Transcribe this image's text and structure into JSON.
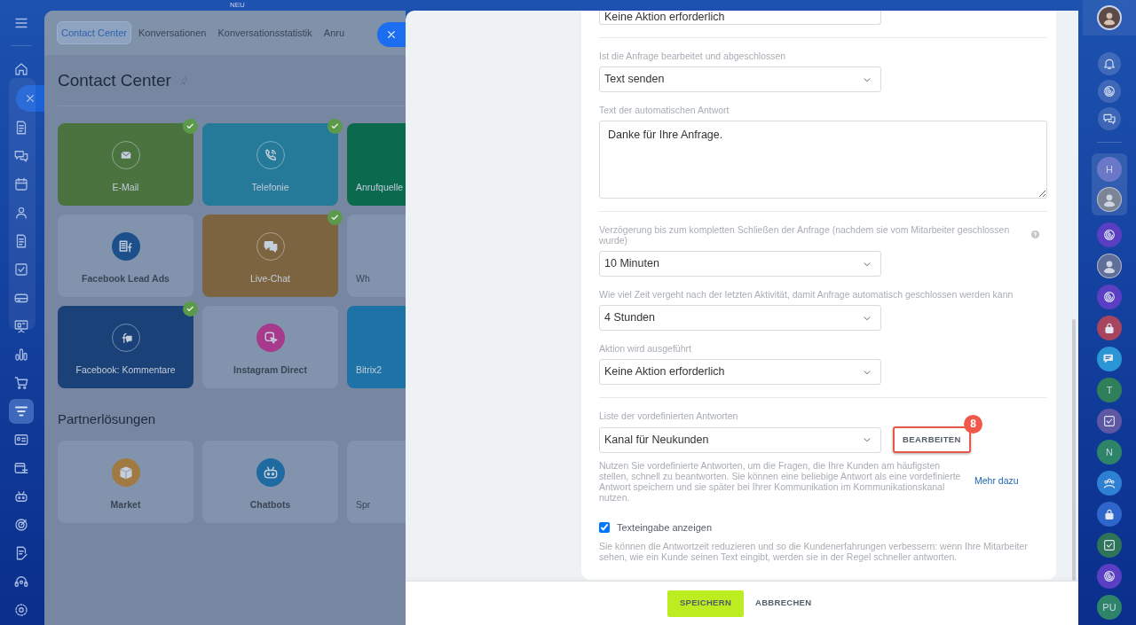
{
  "top_bar": {
    "badge": "NEU"
  },
  "left_rail": [
    {
      "kind": "menu",
      "selected": false
    },
    {
      "kind": "home",
      "selected": false
    },
    {
      "kind": "document",
      "selected": false
    },
    {
      "kind": "chat",
      "selected": false
    },
    {
      "kind": "calendar",
      "selected": false
    },
    {
      "kind": "user",
      "selected": false
    },
    {
      "kind": "document",
      "selected": false
    },
    {
      "kind": "checkbox",
      "selected": false
    },
    {
      "kind": "drive",
      "selected": false
    },
    {
      "kind": "board",
      "selected": false
    },
    {
      "kind": "bar-chart",
      "selected": false
    },
    {
      "kind": "cart",
      "selected": false
    },
    {
      "kind": "filter",
      "selected": true
    },
    {
      "kind": "contact-card",
      "selected": false
    },
    {
      "kind": "planner",
      "selected": false
    },
    {
      "kind": "robot",
      "selected": false
    },
    {
      "kind": "target",
      "selected": false
    },
    {
      "kind": "edit-document",
      "selected": false
    },
    {
      "kind": "headset",
      "selected": false
    },
    {
      "kind": "settings",
      "selected": false
    }
  ],
  "page": {
    "tabs": [
      {
        "label": "Contact Center",
        "selected": true
      },
      {
        "label": "Konversationen",
        "selected": false
      },
      {
        "label": "Konversationsstatistik",
        "selected": false
      },
      {
        "label": "Anru",
        "selected": false
      }
    ],
    "title": "Contact Center",
    "tiles": [
      {
        "label": "E-Mail",
        "kind": "mail",
        "color": "#4a7340",
        "checked": true
      },
      {
        "label": "Telefonie",
        "kind": "phone",
        "color": "#267a99",
        "checked": true
      },
      {
        "label": "Anrufquelle",
        "kind": "none",
        "color": "#0b6a4e",
        "checked": false
      },
      {
        "label": "Facebook Lead Ads",
        "kind": "form",
        "color": "#8293ad",
        "badge": {
          "color": "#1d4f8a"
        },
        "checked": false
      },
      {
        "label": "Live-Chat",
        "kind": "chat",
        "color": "#7d6440",
        "checked": true
      },
      {
        "label": "Wh",
        "kind": "none",
        "color": "#8293ad",
        "checked": false
      },
      {
        "label": "Facebook: Kommentare",
        "kind": "comment",
        "color": "#1b4278",
        "checked": true
      },
      {
        "label": "Instagram Direct",
        "kind": "send",
        "color": "#8293ad",
        "badge": {
          "color": "#a83a8c"
        },
        "checked": false
      },
      {
        "label": "Bitrix2",
        "kind": "none",
        "color": "#1e73a6",
        "checked": false
      }
    ],
    "partner_heading": "Partnerlösungen",
    "partner_tiles": [
      {
        "label": "Market",
        "kind": "box",
        "color": "#8293ad",
        "badge": {
          "color": "#a07a42"
        }
      },
      {
        "label": "Chatbots",
        "kind": "robot",
        "color": "#8293ad",
        "badge": {
          "color": "#1f6aa0"
        }
      },
      {
        "label": "Spr",
        "kind": "none",
        "color": "#8293ad"
      }
    ]
  },
  "form": [
    {
      "kind": "select",
      "value": "Keine Aktion erforderlich",
      "cut": true
    },
    {
      "kind": "divider"
    },
    {
      "kind": "select",
      "label": "Ist die Anfrage bearbeitet und abgeschlossen",
      "value": "Text senden"
    },
    {
      "kind": "textarea",
      "label": "Text der automatischen Antwort",
      "value": "Danke für Ihre Anfrage."
    },
    {
      "kind": "divider"
    },
    {
      "kind": "select",
      "label": "Verzögerung bis zum kompletten Schließen der Anfrage (nachdem sie vom Mitarbeiter geschlossen wurde)",
      "value": "10 Minuten",
      "help": true
    },
    {
      "kind": "select",
      "label": "Wie viel Zeit vergeht nach der letzten Aktivität, damit Anfrage automatisch geschlossen werden kann",
      "value": "4 Stunden"
    },
    {
      "kind": "select",
      "label": "Aktion wird ausgeführt",
      "value": "Keine Aktion erforderlich"
    },
    {
      "kind": "divider"
    },
    {
      "kind": "select",
      "label": "Liste der vordefinierten Antworten",
      "value": "Kanal für Neukunden",
      "button": {
        "label": "BEARBEITEN",
        "highlighted": true,
        "callout": "8"
      },
      "note": "Nutzen Sie vordefinierte Antworten, um die Fragen, die Ihre Kunden am häufigsten stellen, schnell zu beantworten. Sie können eine beliebige Antwort als eine vordefinierte Antwort speichern und sie später bei Ihrer Kommunikation im Kommunikationskanal nutzen.",
      "link": "Mehr dazu"
    },
    {
      "kind": "checkbox",
      "label": "Texteingabe anzeigen",
      "checked": true,
      "note": "Sie können die Antwortzeit reduzieren und so die Kundenerfahrungen verbessern: wenn Ihre Mitarbeiter sehen, wie ein Kunde seinen Text eingibt, werden sie in der Regel schneller antworten."
    }
  ],
  "footer": [
    {
      "label": "SPEICHERN",
      "kind": "primary"
    },
    {
      "label": "ABBRECHEN",
      "kind": "link"
    }
  ],
  "right_bar": {
    "chats": [
      {
        "kind": "letters",
        "text": "H",
        "color": "#6b78c8",
        "pinned": true
      },
      {
        "kind": "avatar",
        "color": "#7b8596",
        "pinned": true
      },
      {
        "kind": "swirl",
        "color": "#5a3fc4"
      },
      {
        "kind": "avatar",
        "color": "#5f6f9a"
      },
      {
        "kind": "swirl",
        "color": "#5a3fc4"
      },
      {
        "kind": "lock",
        "color": "#a8455e"
      },
      {
        "kind": "bubble",
        "color": "#2a96d6"
      },
      {
        "kind": "letters",
        "text": "T",
        "color": "#2f7f5a"
      },
      {
        "kind": "checkbox",
        "color": "#5d57a4"
      },
      {
        "kind": "letters",
        "text": "N",
        "color": "#2e8468"
      },
      {
        "kind": "group",
        "color": "#2e80d4"
      },
      {
        "kind": "lock",
        "color": "#2f66cc"
      },
      {
        "kind": "checkbox",
        "color": "#2e7458"
      },
      {
        "kind": "swirl",
        "color": "#5a3fc4"
      },
      {
        "kind": "letters",
        "text": "PU",
        "color": "#2e8468"
      }
    ]
  }
}
